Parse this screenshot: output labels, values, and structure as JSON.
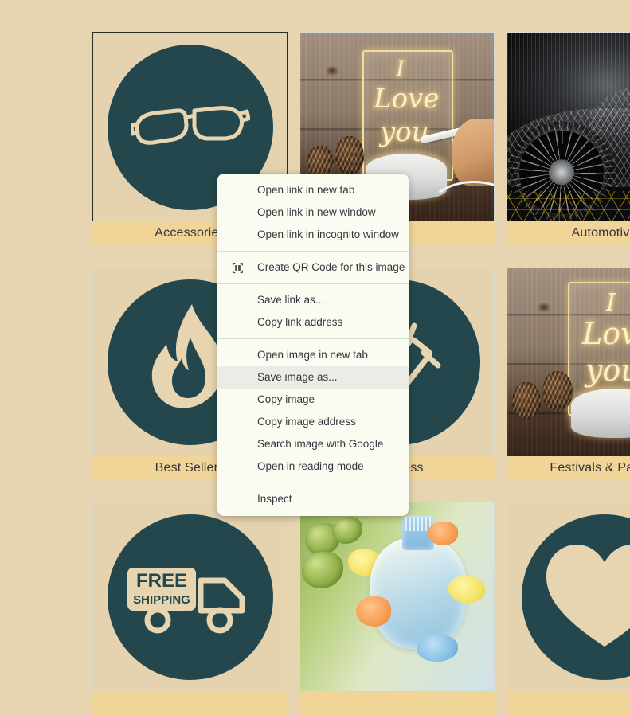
{
  "page": {
    "background_color": "#e6d5b0",
    "label_bar_color": "#f0d498",
    "icon_circle_color": "#23474c",
    "icon_glyph_color": "#e6d5b0"
  },
  "grid": {
    "tiles": [
      {
        "label": "Accessories",
        "art": "glasses-circle",
        "selected": true,
        "row": 1,
        "col": 1
      },
      {
        "label": "",
        "art": "led-note-photo",
        "selected": false,
        "row": 1,
        "col": 2
      },
      {
        "label": "Automotive",
        "art": "wireframe-car-photo",
        "selected": false,
        "row": 1,
        "col": 3
      },
      {
        "label": "Best Sellers",
        "art": "flame-circle",
        "selected": false,
        "row": 2,
        "col": 1
      },
      {
        "label": "Business",
        "art": "handshake-circle",
        "selected": false,
        "row": 2,
        "col": 2
      },
      {
        "label": "Festivals & Parties",
        "art": "led-note-photo",
        "selected": false,
        "row": 2,
        "col": 3
      },
      {
        "label": "",
        "art": "free-shipping-circle",
        "selected": false,
        "row": 3,
        "col": 1
      },
      {
        "label": "",
        "art": "baby-bottle-photo",
        "selected": false,
        "row": 3,
        "col": 2
      },
      {
        "label": "",
        "art": "heart-circle",
        "selected": false,
        "row": 3,
        "col": 3
      }
    ],
    "led_photo_text": {
      "line1": "I",
      "line2": "Love",
      "line3": "you"
    },
    "free_shipping_text": {
      "line1": "FREE",
      "line2": "SHIPPING"
    }
  },
  "context_menu": {
    "background_color": "#fafcf2",
    "separator_color": "#cfe3c8",
    "hover_color": "#ebece6",
    "text_color": "#36363f",
    "groups": [
      {
        "items": [
          {
            "label": "Open link in new tab",
            "icon": "",
            "hovered": false
          },
          {
            "label": "Open link in new window",
            "icon": "",
            "hovered": false
          },
          {
            "label": "Open link in incognito window",
            "icon": "",
            "hovered": false
          }
        ]
      },
      {
        "items": [
          {
            "label": "Create QR Code for this image",
            "icon": "qr-code-icon",
            "hovered": false
          }
        ]
      },
      {
        "items": [
          {
            "label": "Save link as...",
            "icon": "",
            "hovered": false
          },
          {
            "label": "Copy link address",
            "icon": "",
            "hovered": false
          }
        ]
      },
      {
        "items": [
          {
            "label": "Open image in new tab",
            "icon": "",
            "hovered": false
          },
          {
            "label": "Save image as...",
            "icon": "",
            "hovered": true
          },
          {
            "label": "Copy image",
            "icon": "",
            "hovered": false
          },
          {
            "label": "Copy image address",
            "icon": "",
            "hovered": false
          },
          {
            "label": "Search image with Google",
            "icon": "",
            "hovered": false
          },
          {
            "label": "Open in reading mode",
            "icon": "",
            "hovered": false
          }
        ]
      },
      {
        "items": [
          {
            "label": "Inspect",
            "icon": "",
            "hovered": false
          }
        ]
      }
    ]
  }
}
